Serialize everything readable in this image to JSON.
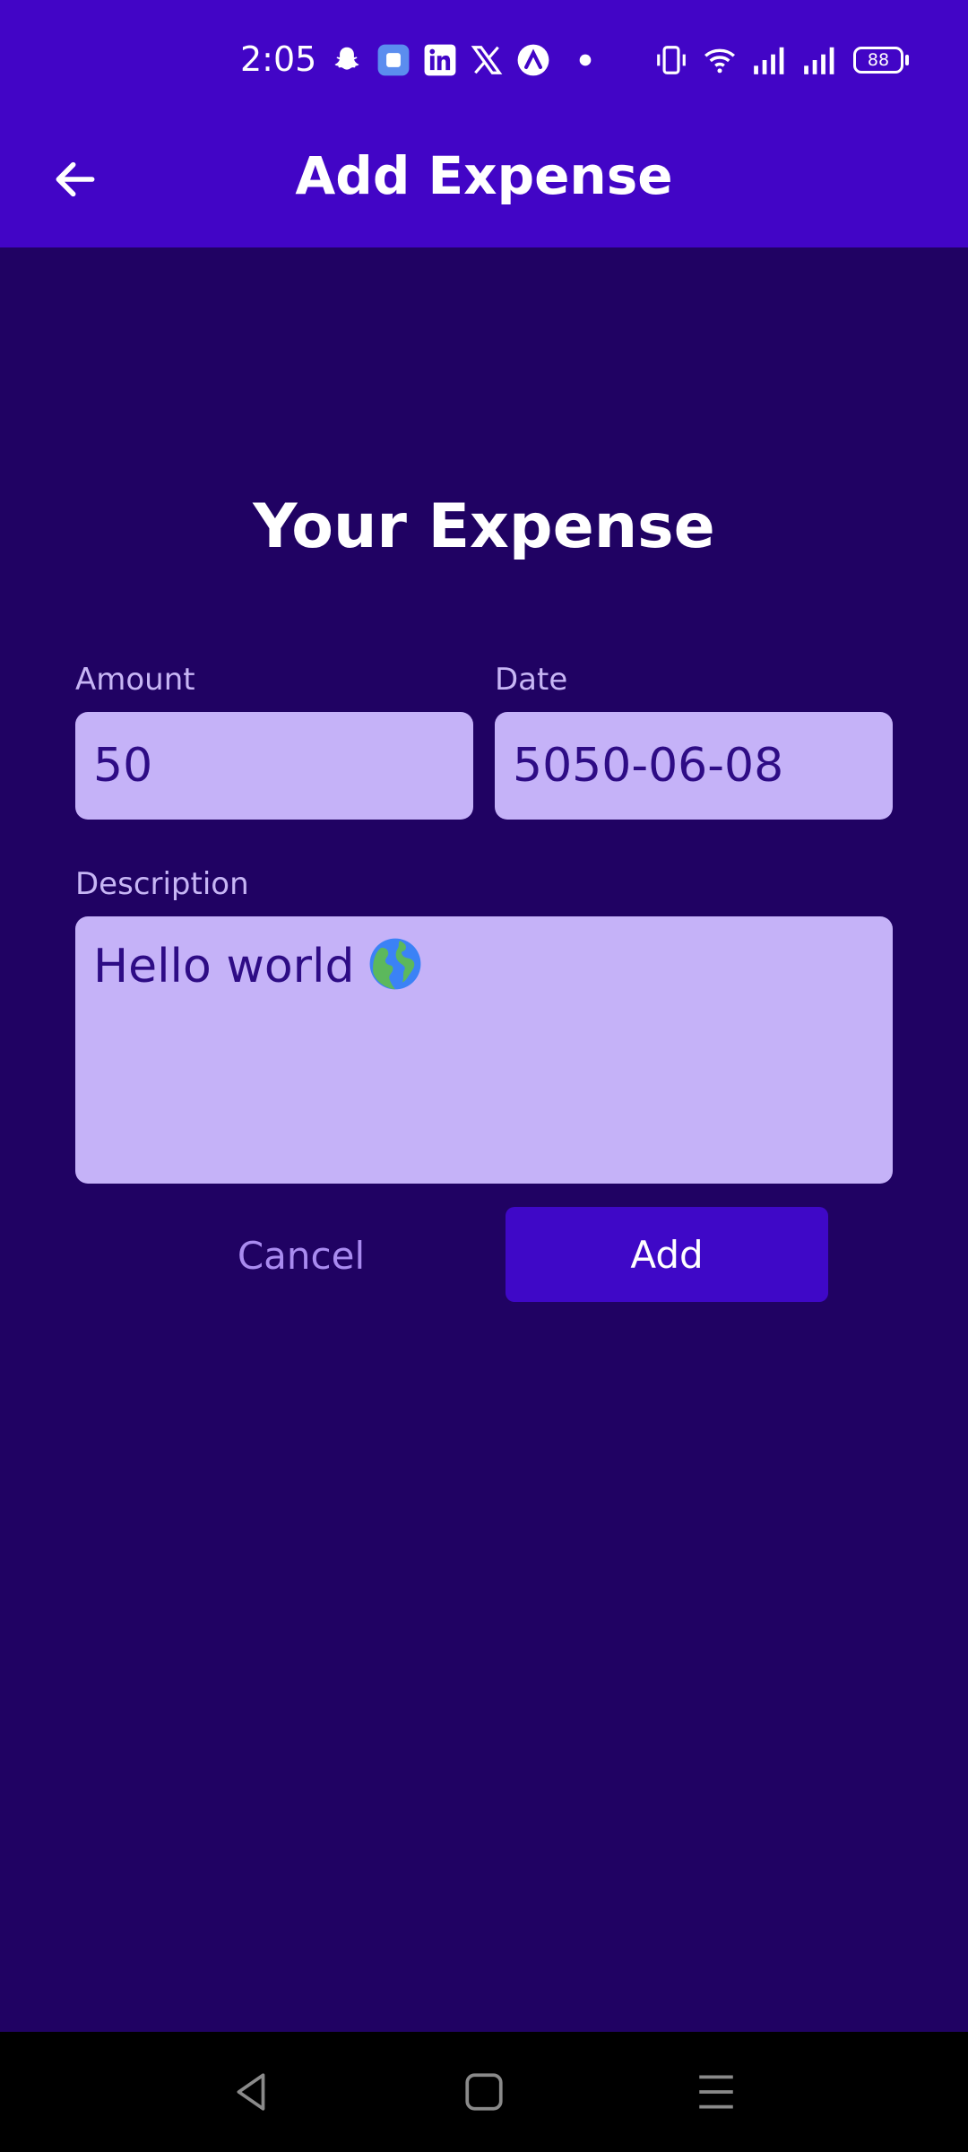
{
  "status_bar": {
    "time": "2:05",
    "battery": "88",
    "icons": [
      "snapchat-icon",
      "messenger-icon",
      "linkedin-icon",
      "x-icon",
      "arc-icon",
      "dot-icon",
      "vibrate-icon",
      "wifi-icon",
      "signal-icon",
      "signal-icon",
      "battery-icon"
    ]
  },
  "app_bar": {
    "title": "Add Expense",
    "back_icon": "arrow-left-icon"
  },
  "form": {
    "title": "Your Expense",
    "amount_label": "Amount",
    "amount_value": "50",
    "date_label": "Date",
    "date_value": "5050-06-08",
    "description_label": "Description",
    "description_value": "Hello world",
    "description_emoji": "globe-icon",
    "cancel_label": "Cancel",
    "add_label": "Add"
  },
  "nav_bar": {
    "icons": [
      "back-triangle-icon",
      "home-square-icon",
      "menu-lines-icon"
    ]
  },
  "colors": {
    "header": "#4205C6",
    "background": "#200263",
    "field": "#C5B2F8",
    "field_text": "#2E0C85",
    "button": "#3F08C7",
    "cancel_text": "#A98BF0"
  }
}
